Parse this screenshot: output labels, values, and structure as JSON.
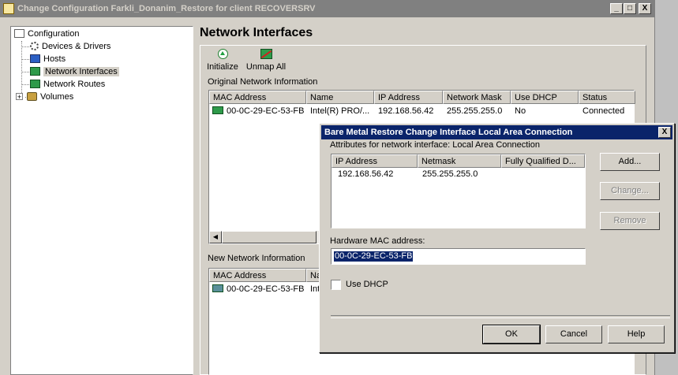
{
  "window": {
    "title": "Change Configuration Farkli_Donanim_Restore for client RECOVERSRV",
    "minimize": "_",
    "maximize": "□",
    "close": "X"
  },
  "tree": {
    "root": "Configuration",
    "items": [
      "Devices & Drivers",
      "Hosts",
      "Network Interfaces",
      "Network Routes",
      "Volumes"
    ],
    "expander": "+"
  },
  "main": {
    "title": "Network Interfaces",
    "toolbar": {
      "initialize": "Initialize",
      "unmap_all": "Unmap All"
    },
    "original": {
      "label": "Original Network Information",
      "columns": [
        "MAC Address",
        "Name",
        "IP Address",
        "Network Mask",
        "Use DHCP",
        "Status"
      ],
      "rows": [
        [
          "00-0C-29-EC-53-FB",
          "Intel(R) PRO/...",
          "192.168.56.42",
          "255.255.255.0",
          "No",
          "Connected"
        ]
      ]
    },
    "new": {
      "label": "New Network Information",
      "columns": [
        "MAC Address",
        "Na"
      ],
      "rows": [
        [
          "00-0C-29-EC-53-FB",
          "Int"
        ]
      ]
    }
  },
  "dialog": {
    "title": "Bare Metal Restore Change Interface Local Area Connection",
    "close": "X",
    "attributes_label": "Attributes for network interface: Local Area Connection",
    "columns": [
      "IP Address",
      "Netmask",
      "Fully Qualified D..."
    ],
    "rows": [
      [
        "192.168.56.42",
        "255.255.255.0",
        ""
      ]
    ],
    "buttons": {
      "add": "Add...",
      "change": "Change...",
      "remove": "Remove",
      "ok": "OK",
      "cancel": "Cancel",
      "help": "Help"
    },
    "mac_label": "Hardware MAC address:",
    "mac_value": "00-0C-29-EC-53-FB",
    "use_dhcp_label": "Use DHCP",
    "use_dhcp_checked": false
  }
}
